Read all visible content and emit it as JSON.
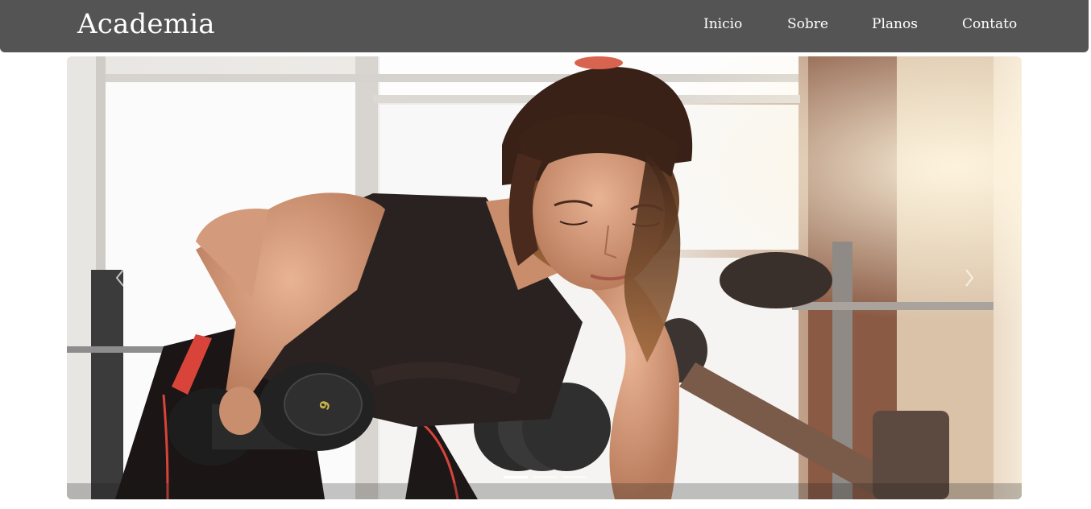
{
  "navbar": {
    "brand": "Academia",
    "links": [
      {
        "label": "Inicio"
      },
      {
        "label": "Sobre"
      },
      {
        "label": "Planos"
      },
      {
        "label": "Contato"
      }
    ],
    "background": "#545454"
  },
  "carousel": {
    "slide_count": 3,
    "active_index": 0,
    "prev_icon": "chevron-left-icon",
    "next_icon": "chevron-right-icon"
  }
}
